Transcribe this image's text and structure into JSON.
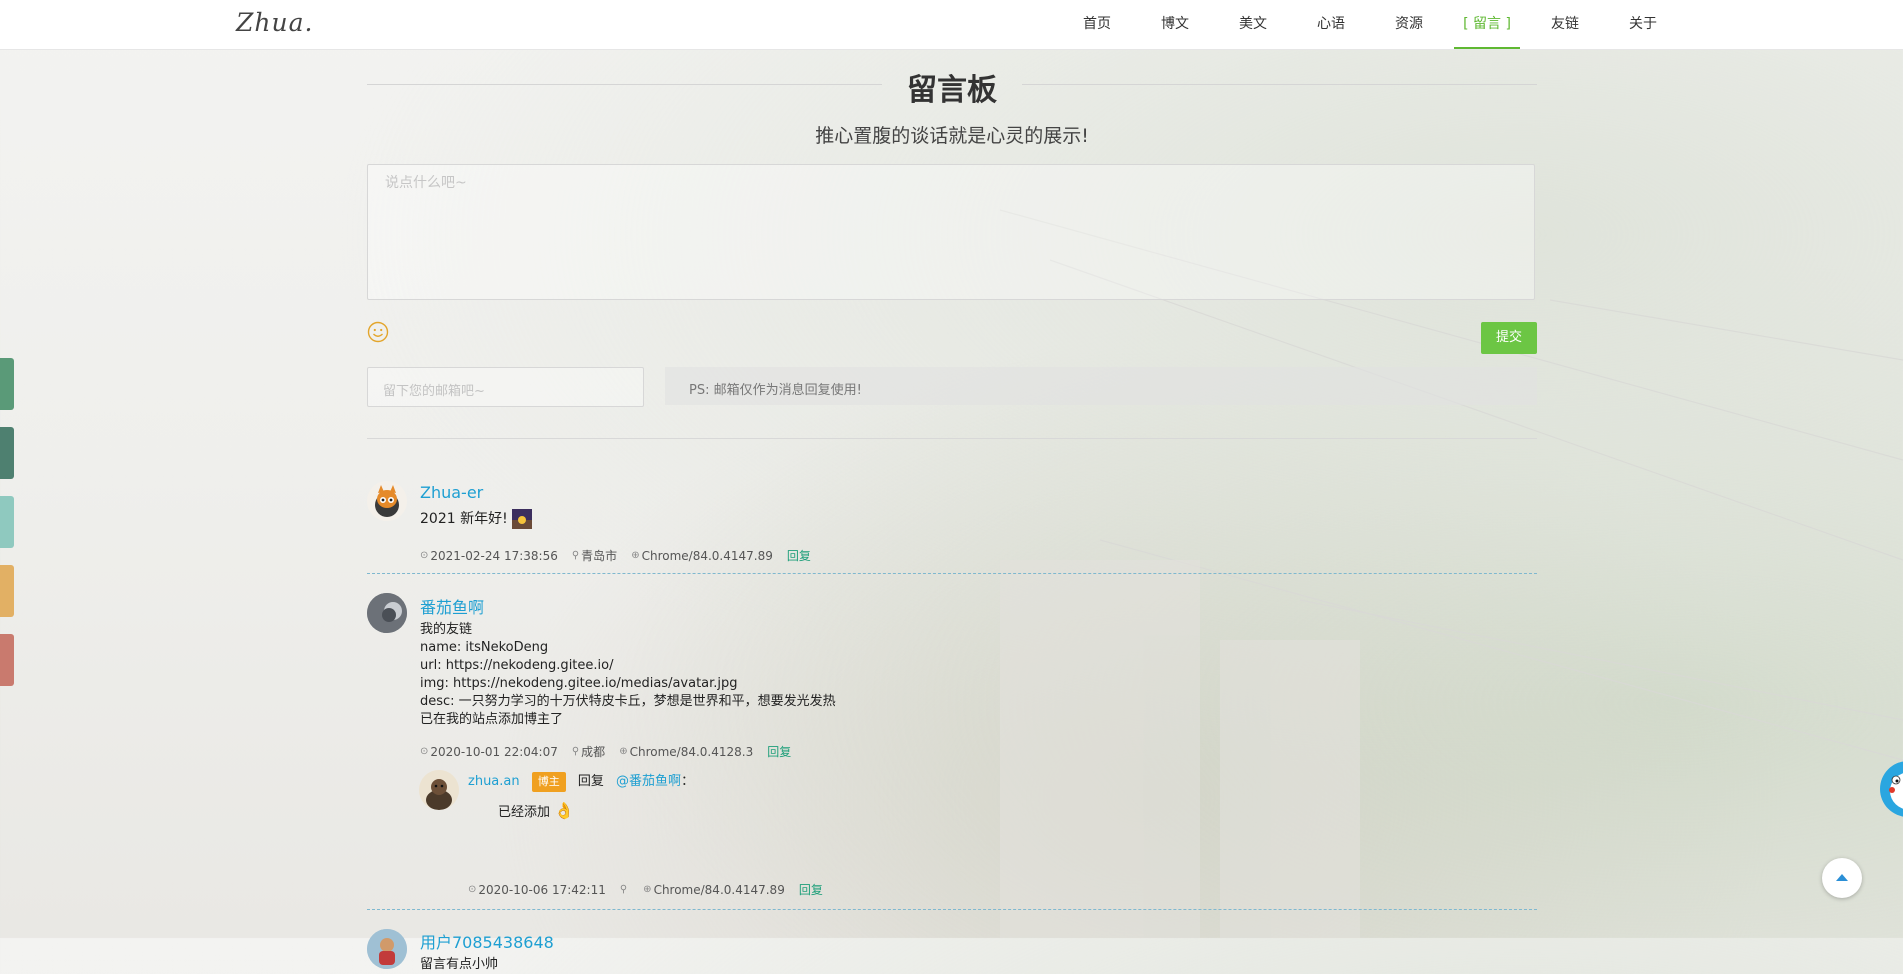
{
  "site": {
    "logo": "Zhua."
  },
  "nav": {
    "items": [
      {
        "label": "首页"
      },
      {
        "label": "博文"
      },
      {
        "label": "美文"
      },
      {
        "label": "心语"
      },
      {
        "label": "资源"
      },
      {
        "label": "[ 留言 ]"
      },
      {
        "label": "友链"
      },
      {
        "label": "关于"
      }
    ],
    "active_color": "#5fb832"
  },
  "side_tabs": {
    "colors": [
      "#5a9a78",
      "#4e8070",
      "#8fc9bf",
      "#e2b064",
      "#c97a6e"
    ]
  },
  "board": {
    "title": "留言板",
    "subtitle": "推心置腹的谈话就是心灵的展示!",
    "textarea_placeholder": "说点什么吧~",
    "emoji_icon": "smile-icon",
    "submit_label": "提交",
    "email_placeholder": "留下您的邮箱吧~",
    "ps_text": "PS: 邮箱仅作为消息回复使用!"
  },
  "comments": [
    {
      "name": "Zhua-er",
      "text": "2021 新年好!",
      "time": "2021-02-24 17:38:56",
      "location": "青岛市",
      "browser": "Chrome/84.0.4147.89",
      "reply": "回复"
    },
    {
      "name": "番茄鱼啊",
      "lines": [
        "我的友链",
        "name: itsNekoDeng",
        "url: https://nekodeng.gitee.io/",
        "img: https://nekodeng.gitee.io/medias/avatar.jpg",
        "desc: 一只努力学习的十万伏特皮卡丘，梦想是世界和平，想要发光发热",
        "已在我的站点添加博主了"
      ],
      "time": "2020-10-01 22:04:07",
      "location": "成都",
      "browser": "Chrome/84.0.4128.3",
      "reply": "回复",
      "replies": [
        {
          "name": "zhua.an",
          "badge": "博主",
          "reply_word": "回复",
          "target": "@番茄鱼啊",
          "colon": "：",
          "text": "已经添加",
          "time": "2020-10-06 17:42:11",
          "location": "",
          "browser": "Chrome/84.0.4147.89",
          "reply": "回复"
        }
      ]
    },
    {
      "name": "用户7085438648",
      "text": "留言有点小帅"
    }
  ]
}
